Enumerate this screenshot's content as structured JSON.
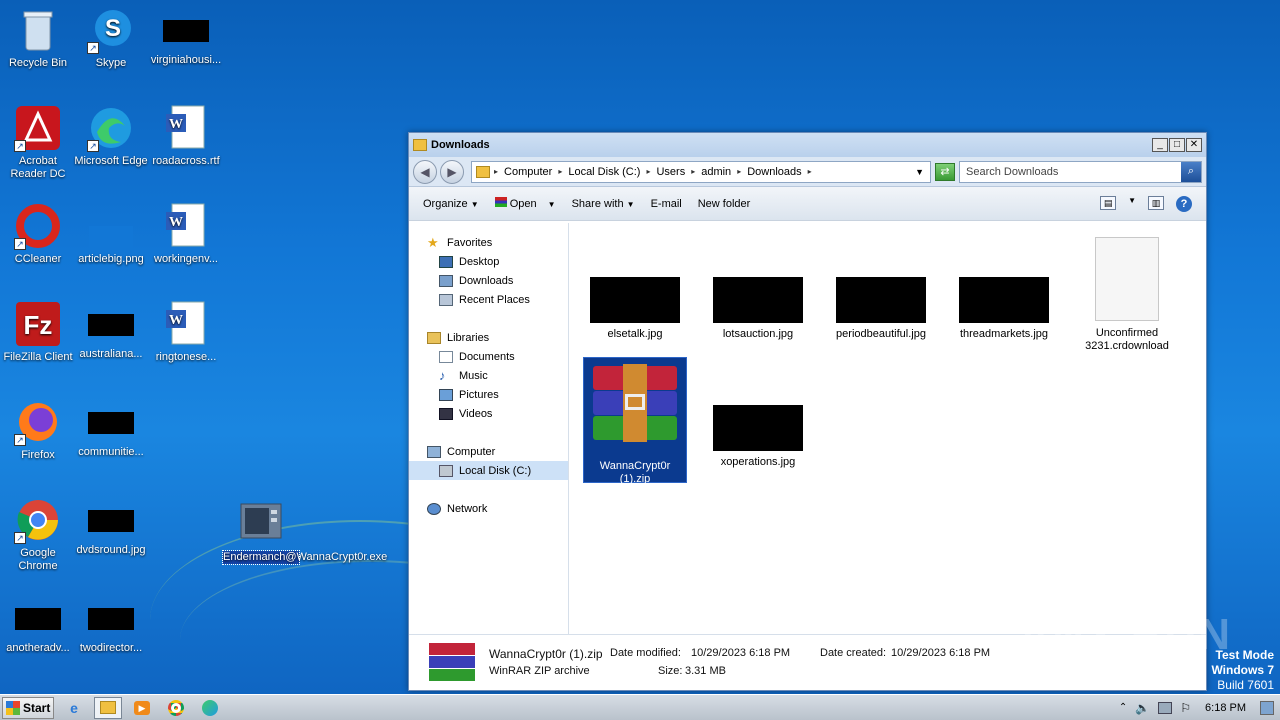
{
  "desktop": {
    "icons": [
      {
        "label": "Recycle Bin"
      },
      {
        "label": "Skype"
      },
      {
        "label": "virginiahousi..."
      },
      {
        "label": "Acrobat Reader DC"
      },
      {
        "label": "Microsoft Edge"
      },
      {
        "label": "roadacross.rtf"
      },
      {
        "label": "CCleaner"
      },
      {
        "label": "articlebig.png"
      },
      {
        "label": "workingenv..."
      },
      {
        "label": "FileZilla Client"
      },
      {
        "label": "australiana..."
      },
      {
        "label": "ringtonese..."
      },
      {
        "label": "Firefox"
      },
      {
        "label": "communitie..."
      },
      {
        "label": "Google Chrome"
      },
      {
        "label": "dvdsround.jpg"
      },
      {
        "label": "anotheradv..."
      },
      {
        "label": "twodirector..."
      },
      {
        "label": "Endermanch@WannaCrypt0r.exe"
      }
    ]
  },
  "window": {
    "title": "Downloads",
    "breadcrumb": [
      "Computer",
      "Local Disk (C:)",
      "Users",
      "admin",
      "Downloads"
    ],
    "search_placeholder": "Search Downloads",
    "toolbar": {
      "organize": "Organize",
      "open": "Open",
      "share": "Share with",
      "email": "E-mail",
      "newfolder": "New folder"
    },
    "nav": {
      "favorites": "Favorites",
      "desktop": "Desktop",
      "downloads": "Downloads",
      "recent": "Recent Places",
      "libraries": "Libraries",
      "documents": "Documents",
      "music": "Music",
      "pictures": "Pictures",
      "videos": "Videos",
      "computer": "Computer",
      "localdisk": "Local Disk (C:)",
      "network": "Network"
    },
    "files": [
      {
        "name": "elsetalk.jpg"
      },
      {
        "name": "lotsauction.jpg"
      },
      {
        "name": "periodbeautiful.jpg"
      },
      {
        "name": "threadmarkets.jpg"
      },
      {
        "name": "Unconfirmed 3231.crdownload"
      },
      {
        "name": "WannaCrypt0r (1).zip"
      },
      {
        "name": "xoperations.jpg"
      }
    ],
    "details": {
      "filename": "WannaCrypt0r (1).zip",
      "type": "WinRAR ZIP archive",
      "modified_label": "Date modified:",
      "modified": "10/29/2023 6:18 PM",
      "created_label": "Date created:",
      "created": "10/29/2023 6:18 PM",
      "size_label": "Size:",
      "size": "3.31 MB"
    }
  },
  "taskbar": {
    "start": "Start",
    "clock": "6:18 PM"
  },
  "watermark": "ANY RUN",
  "testmode": {
    "line1": "Test Mode",
    "line2": "Windows 7",
    "line3": "Build 7601"
  }
}
